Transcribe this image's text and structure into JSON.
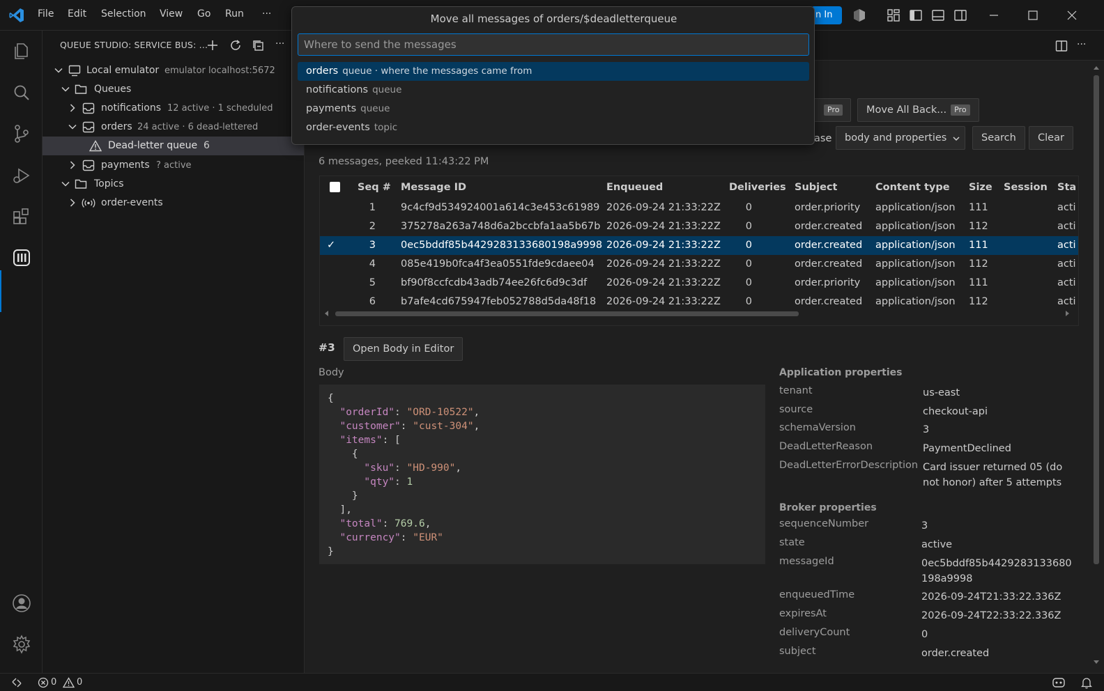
{
  "menu": [
    "File",
    "Edit",
    "Selection",
    "View",
    "Go",
    "Run",
    "···"
  ],
  "signin_label": "n In",
  "sidebar": {
    "title": "QUEUE STUDIO: SERVICE BUS: ...",
    "tree": {
      "emulator_label": "Local emulator",
      "emulator_desc": "emulator localhost:5672",
      "queues_label": "Queues",
      "notifications_label": "notifications",
      "notifications_desc": "12 active · 1 scheduled",
      "orders_label": "orders",
      "orders_desc": "24 active · 6 dead-lettered",
      "dlq_label": "Dead-letter queue",
      "dlq_count": "6",
      "payments_label": "payments",
      "payments_desc": "? active",
      "topics_label": "Topics",
      "order_events_label": "order-events"
    }
  },
  "quickpick": {
    "title": "Move all messages of orders/$deadletterqueue",
    "placeholder": "Where to send the messages",
    "items": [
      {
        "label": "orders",
        "desc": "queue · where the messages came from"
      },
      {
        "label": "notifications",
        "desc": "queue"
      },
      {
        "label": "payments",
        "desc": "queue"
      },
      {
        "label": "order-events",
        "desc": "topic"
      }
    ]
  },
  "toolbar": {
    "pro_badge": "Pro",
    "move_all_back": "Move All Back...",
    "search_in_fragment": "ase",
    "search_scope": "body and properties",
    "search_button": "Search",
    "clear_button": "Clear"
  },
  "summary": "6 messages, peeked 11:43:22 PM",
  "table": {
    "headers": [
      "Seq #",
      "Message ID",
      "Enqueued",
      "Deliveries",
      "Subject",
      "Content type",
      "Size",
      "Session",
      "Sta"
    ],
    "rows": [
      {
        "seq": "1",
        "id": "9c4cf9d534924001a614c3e453c61989",
        "enq": "2026-09-24 21:33:22Z",
        "del": "0",
        "subject": "order.priority",
        "ctype": "application/json",
        "size": "111",
        "session": "",
        "state": "acti",
        "checked": ""
      },
      {
        "seq": "2",
        "id": "375278a263a748d6a2bccbfa1aa5b67b",
        "enq": "2026-09-24 21:33:22Z",
        "del": "0",
        "subject": "order.created",
        "ctype": "application/json",
        "size": "112",
        "session": "",
        "state": "acti",
        "checked": ""
      },
      {
        "seq": "3",
        "id": "0ec5bddf85b4429283133680198a9998",
        "enq": "2026-09-24 21:33:22Z",
        "del": "0",
        "subject": "order.created",
        "ctype": "application/json",
        "size": "111",
        "session": "",
        "state": "acti",
        "checked": "✓"
      },
      {
        "seq": "4",
        "id": "085e419b0fca4f3ea0551fde9cdaee04",
        "enq": "2026-09-24 21:33:22Z",
        "del": "0",
        "subject": "order.created",
        "ctype": "application/json",
        "size": "112",
        "session": "",
        "state": "acti",
        "checked": ""
      },
      {
        "seq": "5",
        "id": "bf90f8ccfcdb43adb74ee26fc6d9c3df",
        "enq": "2026-09-24 21:33:22Z",
        "del": "0",
        "subject": "order.priority",
        "ctype": "application/json",
        "size": "111",
        "session": "",
        "state": "acti",
        "checked": ""
      },
      {
        "seq": "6",
        "id": "b7afe4cd675947feb052788d5da48f18",
        "enq": "2026-09-24 21:33:22Z",
        "del": "0",
        "subject": "order.created",
        "ctype": "application/json",
        "size": "112",
        "session": "",
        "state": "acti",
        "checked": ""
      }
    ]
  },
  "detail": {
    "seq_label": "#3",
    "open_body_button": "Open Body in Editor",
    "body_label": "Body",
    "body_lines": [
      [
        {
          "t": "p",
          "v": "{"
        }
      ],
      [
        {
          "t": "p",
          "v": "  "
        },
        {
          "t": "k",
          "v": "\"orderId\""
        },
        {
          "t": "p",
          "v": ": "
        },
        {
          "t": "s",
          "v": "\"ORD-10522\""
        },
        {
          "t": "p",
          "v": ","
        }
      ],
      [
        {
          "t": "p",
          "v": "  "
        },
        {
          "t": "k",
          "v": "\"customer\""
        },
        {
          "t": "p",
          "v": ": "
        },
        {
          "t": "s",
          "v": "\"cust-304\""
        },
        {
          "t": "p",
          "v": ","
        }
      ],
      [
        {
          "t": "p",
          "v": "  "
        },
        {
          "t": "k",
          "v": "\"items\""
        },
        {
          "t": "p",
          "v": ": ["
        }
      ],
      [
        {
          "t": "p",
          "v": "    {"
        }
      ],
      [
        {
          "t": "p",
          "v": "      "
        },
        {
          "t": "k",
          "v": "\"sku\""
        },
        {
          "t": "p",
          "v": ": "
        },
        {
          "t": "s",
          "v": "\"HD-990\""
        },
        {
          "t": "p",
          "v": ","
        }
      ],
      [
        {
          "t": "p",
          "v": "      "
        },
        {
          "t": "k",
          "v": "\"qty\""
        },
        {
          "t": "p",
          "v": ": "
        },
        {
          "t": "n",
          "v": "1"
        }
      ],
      [
        {
          "t": "p",
          "v": "    }"
        }
      ],
      [
        {
          "t": "p",
          "v": "  ],"
        }
      ],
      [
        {
          "t": "p",
          "v": "  "
        },
        {
          "t": "k",
          "v": "\"total\""
        },
        {
          "t": "p",
          "v": ": "
        },
        {
          "t": "n",
          "v": "769.6"
        },
        {
          "t": "p",
          "v": ","
        }
      ],
      [
        {
          "t": "p",
          "v": "  "
        },
        {
          "t": "k",
          "v": "\"currency\""
        },
        {
          "t": "p",
          "v": ": "
        },
        {
          "t": "s",
          "v": "\"EUR\""
        }
      ],
      [
        {
          "t": "p",
          "v": "}"
        }
      ]
    ],
    "app_props_title": "Application properties",
    "app_props": [
      {
        "k": "tenant",
        "v": "us-east"
      },
      {
        "k": "source",
        "v": "checkout-api"
      },
      {
        "k": "schemaVersion",
        "v": "3"
      },
      {
        "k": "DeadLetterReason",
        "v": "PaymentDeclined"
      },
      {
        "k": "DeadLetterErrorDescription",
        "v": "Card issuer returned 05 (do not honor) after 5 attempts"
      }
    ],
    "broker_props_title": "Broker properties",
    "broker_props": [
      {
        "k": "sequenceNumber",
        "v": "3"
      },
      {
        "k": "state",
        "v": "active"
      },
      {
        "k": "messageId",
        "v": "0ec5bddf85b4429283133680198a9998"
      },
      {
        "k": "enqueuedTime",
        "v": "2026-09-24T21:33:22.336Z"
      },
      {
        "k": "expiresAt",
        "v": "2026-09-24T22:33:22.336Z"
      },
      {
        "k": "deliveryCount",
        "v": "0"
      },
      {
        "k": "subject",
        "v": "order.created"
      }
    ]
  },
  "status": {
    "errors": "0",
    "warnings": "0"
  }
}
